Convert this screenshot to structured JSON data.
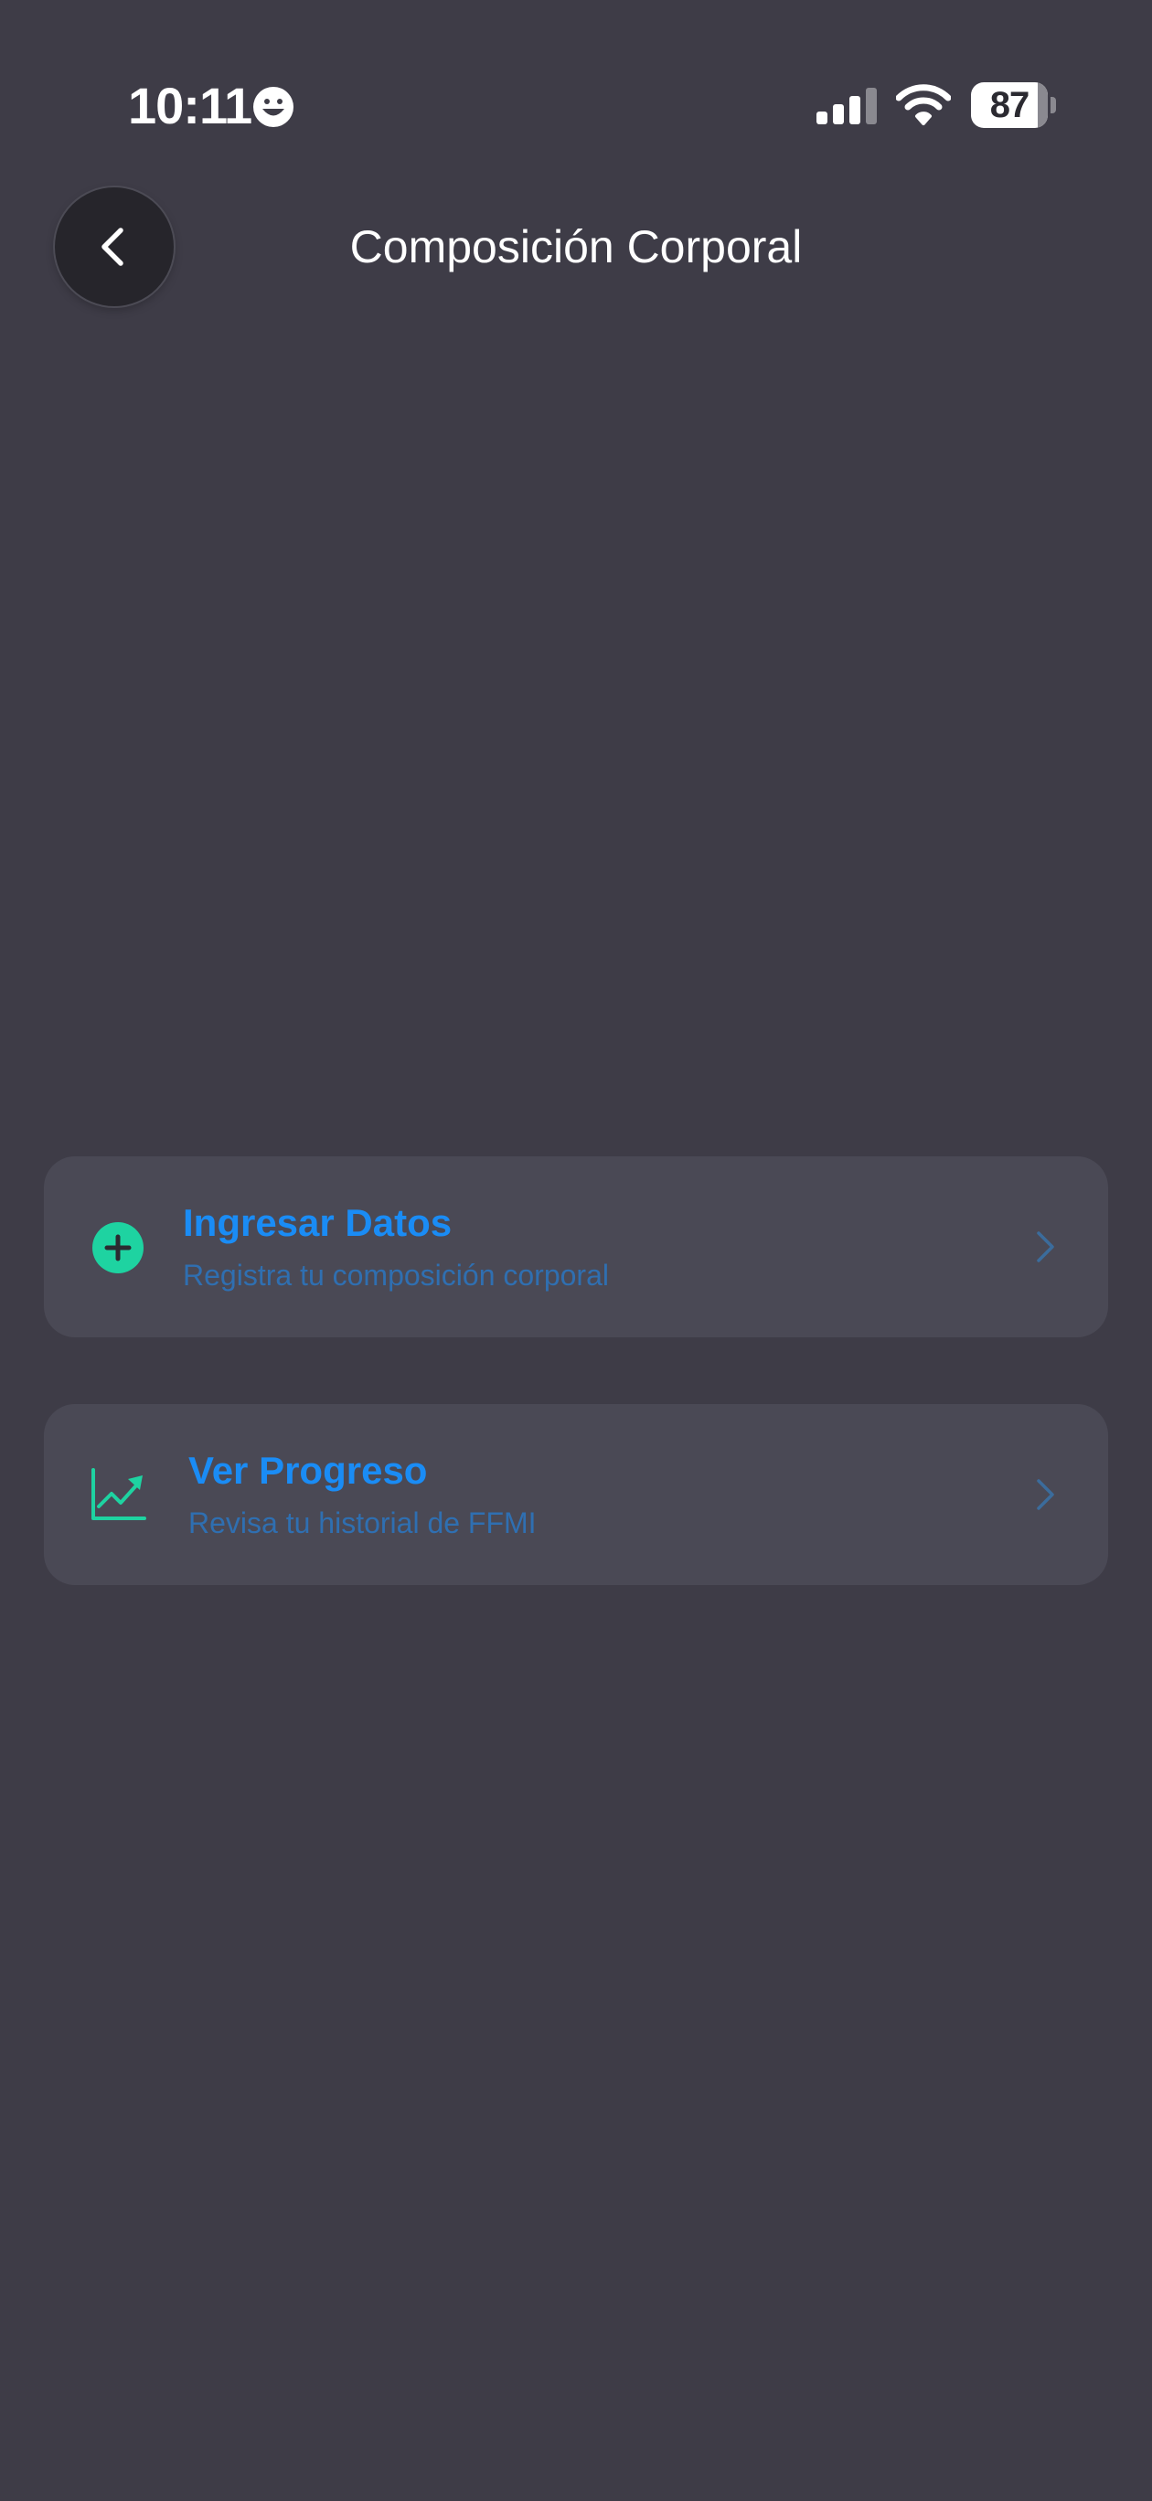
{
  "status_bar": {
    "time": "10:11",
    "battery_level": "87",
    "battery_fraction": 0.87,
    "icons": [
      "focus-smile-icon",
      "cellular-signal-icon",
      "wifi-icon",
      "battery-icon"
    ]
  },
  "header": {
    "back_icon": "chevron-left-icon",
    "title": "Composición Corporal"
  },
  "menu": {
    "items": [
      {
        "icon": "plus-circle-icon",
        "title": "Ingresar Datos",
        "subtitle": "Registra tu composición corporal",
        "chevron_icon": "chevron-right-icon"
      },
      {
        "icon": "trend-chart-icon",
        "title": "Ver Progreso",
        "subtitle": "Revisa tu historial de FFMI",
        "chevron_icon": "chevron-right-icon"
      }
    ]
  },
  "colors": {
    "background": "#3e3c47",
    "card_background": "#4a4955",
    "back_button_background": "#26252b",
    "accent_green": "#1ed3a1",
    "title_blue": "#1a8cf5",
    "subtitle_blue": "#2f6fb1",
    "chevron": "#3b6c9c",
    "text_primary": "#ffffff"
  }
}
